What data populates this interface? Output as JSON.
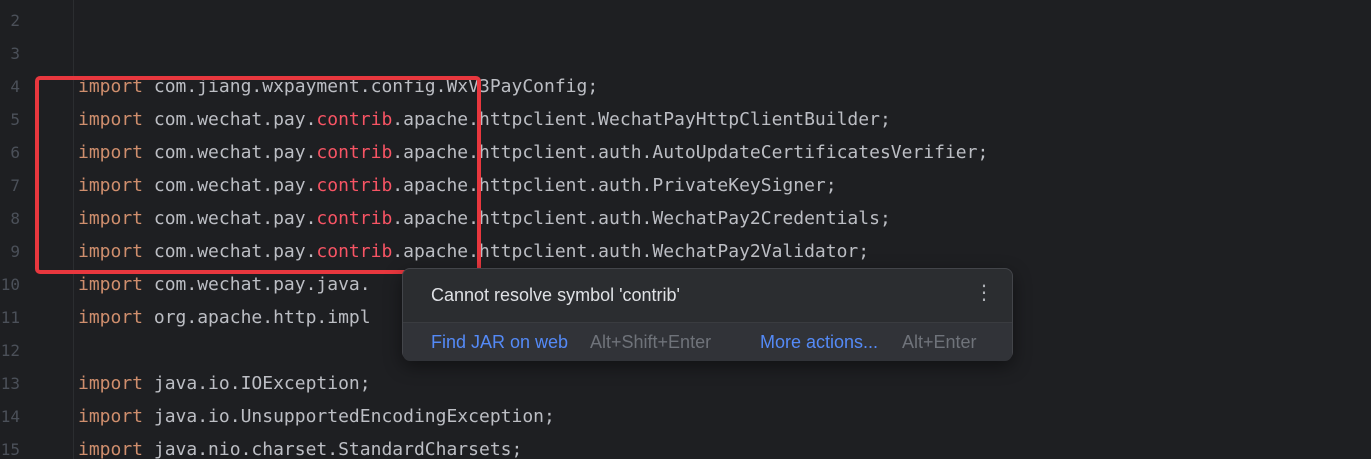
{
  "lines": [
    {
      "num": "2",
      "segments": []
    },
    {
      "num": "3",
      "segments": []
    },
    {
      "num": "4",
      "segments": [
        {
          "t": "import",
          "c": "kw"
        },
        {
          "t": " com.jiang.wxpayment.config.WxV3PayConfig;",
          "c": "plain"
        }
      ]
    },
    {
      "num": "5",
      "segments": [
        {
          "t": "import",
          "c": "kw"
        },
        {
          "t": " com.wechat.pay.",
          "c": "plain"
        },
        {
          "t": "contrib",
          "c": "err"
        },
        {
          "t": ".apache.httpclient.WechatPayHttpClientBuilder;",
          "c": "plain"
        }
      ]
    },
    {
      "num": "6",
      "segments": [
        {
          "t": "import",
          "c": "kw"
        },
        {
          "t": " com.wechat.pay.",
          "c": "plain"
        },
        {
          "t": "contrib",
          "c": "err"
        },
        {
          "t": ".apache.httpclient.auth.AutoUpdateCertificatesVerifier;",
          "c": "plain"
        }
      ]
    },
    {
      "num": "7",
      "segments": [
        {
          "t": "import",
          "c": "kw"
        },
        {
          "t": " com.wechat.pay.",
          "c": "plain"
        },
        {
          "t": "contrib",
          "c": "err"
        },
        {
          "t": ".apache.httpclient.auth.PrivateKeySigner;",
          "c": "plain"
        }
      ]
    },
    {
      "num": "8",
      "segments": [
        {
          "t": "import",
          "c": "kw"
        },
        {
          "t": " com.wechat.pay.",
          "c": "plain"
        },
        {
          "t": "contrib",
          "c": "err"
        },
        {
          "t": ".apache.httpclient.auth.WechatPay2Credentials;",
          "c": "plain"
        }
      ]
    },
    {
      "num": "9",
      "segments": [
        {
          "t": "import",
          "c": "kw"
        },
        {
          "t": " com.wechat.pay.",
          "c": "plain"
        },
        {
          "t": "contrib",
          "c": "err"
        },
        {
          "t": ".apache.httpclient.auth.WechatPay2Validator;",
          "c": "plain"
        }
      ]
    },
    {
      "num": "10",
      "segments": [
        {
          "t": "import",
          "c": "kw"
        },
        {
          "t": " com.wechat.pay.java.",
          "c": "plain"
        }
      ]
    },
    {
      "num": "11",
      "segments": [
        {
          "t": "import",
          "c": "kw"
        },
        {
          "t": " org.apache.http.impl",
          "c": "plain"
        }
      ]
    },
    {
      "num": "12",
      "segments": []
    },
    {
      "num": "13",
      "segments": [
        {
          "t": "import",
          "c": "kw"
        },
        {
          "t": " java.io.IOException;",
          "c": "plain"
        }
      ]
    },
    {
      "num": "14",
      "segments": [
        {
          "t": "import",
          "c": "kw"
        },
        {
          "t": " java.io.UnsupportedEncodingException;",
          "c": "plain"
        }
      ]
    },
    {
      "num": "15",
      "segments": [
        {
          "t": "import",
          "c": "kw"
        },
        {
          "t": " java.nio.charset.StandardCharsets;",
          "c": "plain"
        }
      ]
    }
  ],
  "popup": {
    "message": "Cannot resolve symbol 'contrib'",
    "menu_glyph": "⋮",
    "find_jar_label": "Find JAR on web",
    "find_jar_shortcut": "Alt+Shift+Enter",
    "more_actions_label": "More actions...",
    "more_actions_shortcut": "Alt+Enter"
  },
  "colors": {
    "background": "#1e1f22",
    "keyword": "#cf8e6d",
    "unresolved": "#f75464",
    "text": "#bcbec4",
    "highlight_box": "#e8373e",
    "link": "#548af7"
  }
}
